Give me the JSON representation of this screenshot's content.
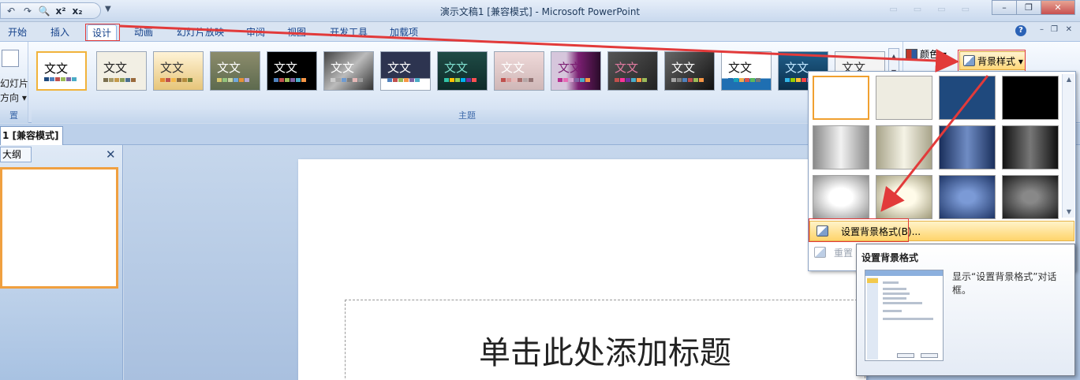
{
  "window": {
    "title": "演示文稿1 [兼容模式] - Microsoft PowerPoint"
  },
  "qat": {
    "items": [
      {
        "name": "undo-icon",
        "glyph": "↶"
      },
      {
        "name": "redo-icon",
        "glyph": "↷"
      },
      {
        "name": "print-preview-icon",
        "glyph": "🔍"
      },
      {
        "name": "superscript-icon",
        "glyph": "x²"
      },
      {
        "name": "subscript-icon",
        "glyph": "x₂"
      }
    ],
    "more_glyph": "▼"
  },
  "tabs": [
    {
      "label": "开始"
    },
    {
      "label": "插入"
    },
    {
      "label": "设计"
    },
    {
      "label": "动画"
    },
    {
      "label": "幻灯片放映"
    },
    {
      "label": "审阅"
    },
    {
      "label": "视图"
    },
    {
      "label": "开发工具"
    },
    {
      "label": "加载项"
    }
  ],
  "ribbon": {
    "page_setup": {
      "label_1": "幻灯片",
      "label_2": "方向 ▾",
      "group_label": "置"
    },
    "themes_group_label": "主题",
    "theme_text": "文文",
    "colors_label": "颜色 ▾",
    "bg_style_label": "背景样式 ▾"
  },
  "doc_tab": {
    "label": "1 [兼容模式]"
  },
  "left_pane": {
    "tab_label": "大纲",
    "close_glyph": "✕"
  },
  "slide": {
    "title_placeholder": "单击此处添加标题"
  },
  "dropdown": {
    "format_bg_label": "设置背景格式(B)...",
    "reset_label": "重置"
  },
  "tooltip": {
    "title": "设置背景格式",
    "description": "显示“设置背景格式”对话框。"
  },
  "colors": {
    "highlight_red": "#e23a3a",
    "selection_orange": "#f0a030",
    "ribbon_blue": "#dde8f6"
  }
}
